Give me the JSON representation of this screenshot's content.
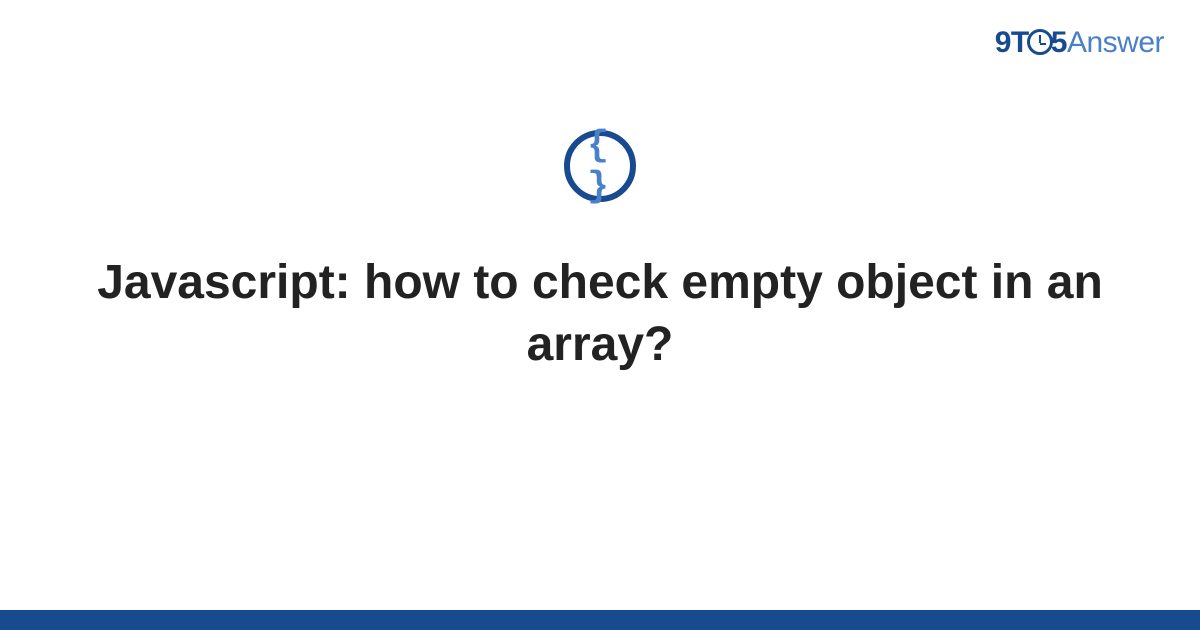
{
  "logo": {
    "part1": "9T",
    "part2": "5",
    "part3": "Answer"
  },
  "icon": {
    "braces": "{ }"
  },
  "title": "Javascript: how to check empty object in an array?"
}
